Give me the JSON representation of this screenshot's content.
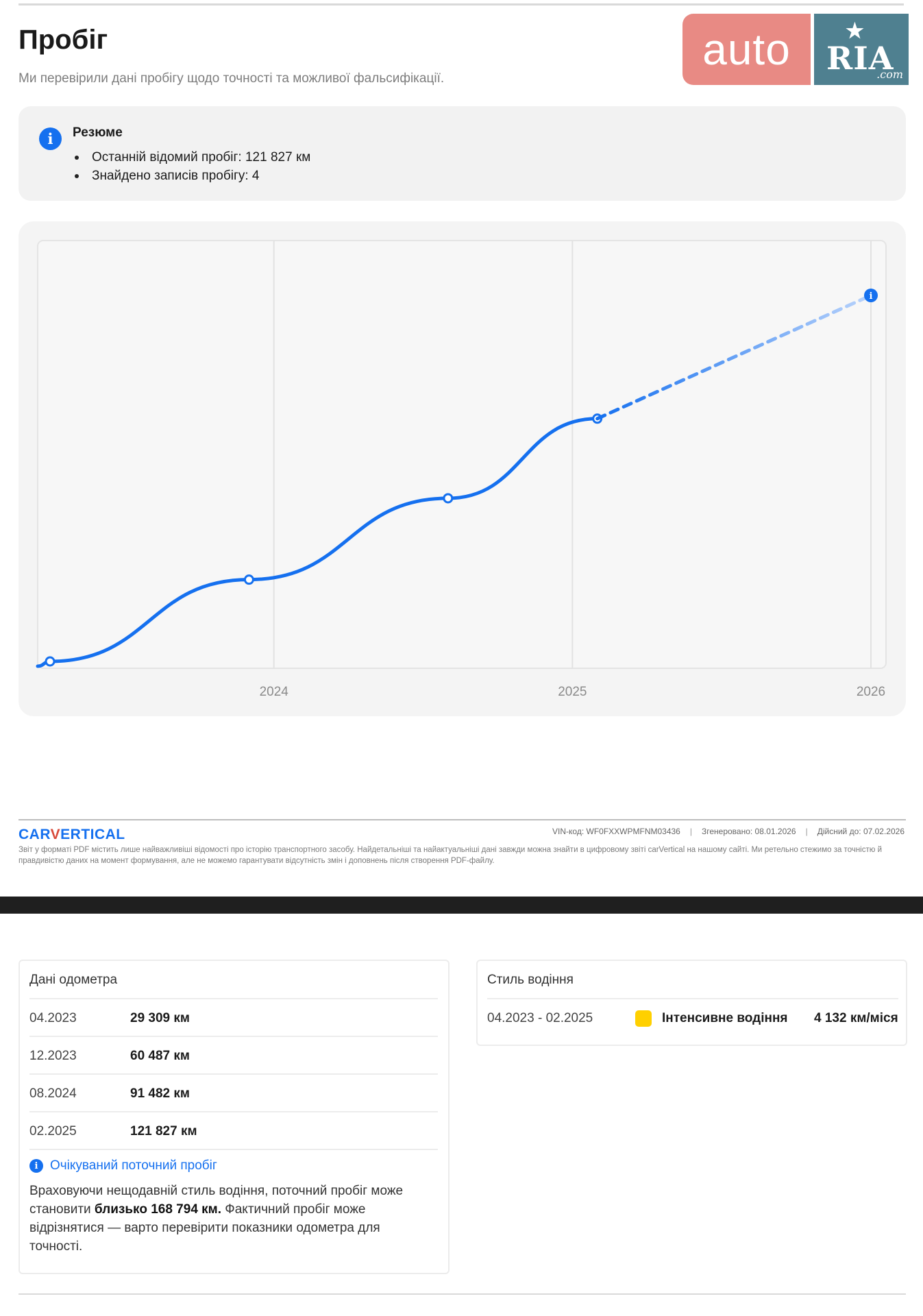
{
  "header": {
    "title": "Пробіг",
    "subtitle": "Ми перевірили дані пробігу щодо точності та можливої фальсифікації."
  },
  "watermark": {
    "auto_text": "auto",
    "ria_text": "RIA",
    "ria_suffix": ".com",
    "colors": {
      "auto_bg": "#e88a84",
      "ria_bg": "#4f8090"
    }
  },
  "summary": {
    "title": "Резюме",
    "items": [
      "Останній відомий пробіг: 121 827 км",
      "Знайдено записів пробігу: 4"
    ]
  },
  "chart_data": {
    "type": "line",
    "title": "",
    "xlabel": "",
    "ylabel": "",
    "x_tick_labels": [
      "2024",
      "2025",
      "2026"
    ],
    "x_range": [
      "2023-04",
      "2026-01"
    ],
    "grid": true,
    "series": [
      {
        "style": "solid",
        "points": [
          {
            "x": "2023-04",
            "y": 29309
          },
          {
            "x": "2023-12",
            "y": 60487
          },
          {
            "x": "2024-08",
            "y": 91482
          },
          {
            "x": "2025-02",
            "y": 121827
          }
        ]
      },
      {
        "style": "dashed",
        "points": [
          {
            "x": "2025-02",
            "y": 121827
          },
          {
            "x": "2026-01",
            "y": 168794
          }
        ]
      }
    ],
    "color": "#1570ef"
  },
  "footer": {
    "brand_left": "CAR",
    "brand_v": "V",
    "brand_right": "ERTICAL",
    "vin": "VIN-код: WF0FXXWPMFNM03436",
    "generated": "Згенеровано: 08.01.2026",
    "valid_until": "Дійсний до: 07.02.2026",
    "disclaimer": "Звіт у форматі PDF містить лише найважливіші відомості про історію транспортного засобу. Найдетальніші та найактуальніші дані завжди можна знайти в цифровому звіті carVertical на нашому сайті. Ми ретельно стежимо за точністю й правдивістю даних на момент формування, але не можемо гарантувати відсутність змін і доповнень після створення PDF-файлу."
  },
  "odometer": {
    "title": "Дані одометра",
    "rows": [
      {
        "date": "04.2023",
        "km": "29 309 км"
      },
      {
        "date": "12.2023",
        "km": "60 487 км"
      },
      {
        "date": "08.2024",
        "km": "91 482 км"
      },
      {
        "date": "02.2025",
        "km": "121 827 км"
      }
    ],
    "expected_title": "Очікуваний поточний пробіг",
    "expected_text_1": "Враховуючи нещодавній стиль водіння, поточний пробіг може становити ",
    "expected_text_bold": "близько 168 794 км.",
    "expected_text_2": " Фактичний пробіг може відрізнятися — варто перевірити показники одометра для точності."
  },
  "driving_style": {
    "title": "Стиль водіння",
    "period": "04.2023 - 02.2025",
    "label": "Інтенсивне водіння",
    "rate": "4 132 км/міся",
    "indicator_color": "#ffd000"
  }
}
